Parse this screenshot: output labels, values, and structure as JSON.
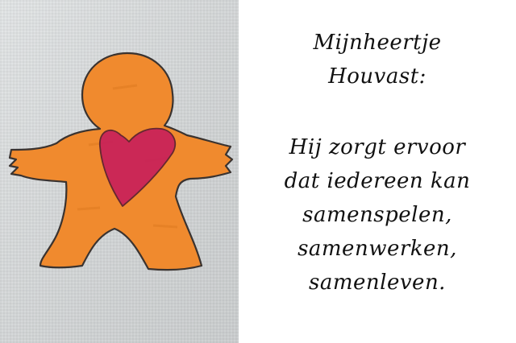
{
  "colors": {
    "canvas": "#d9dcdd",
    "figure_fill": "#f08a2e",
    "figure_outline": "#3a3330",
    "heart": "#c8205a",
    "text": "#111111"
  },
  "illustration": {
    "figure_icon": "orange-person-figure",
    "heart_icon": "red-heart"
  },
  "caption": {
    "title_lines": [
      "Mijnheertje",
      "Houvast:"
    ],
    "body_lines": [
      "Hij zorgt ervoor",
      "dat iedereen kan",
      "samenspelen,",
      "samenwerken,",
      "samenleven."
    ]
  }
}
